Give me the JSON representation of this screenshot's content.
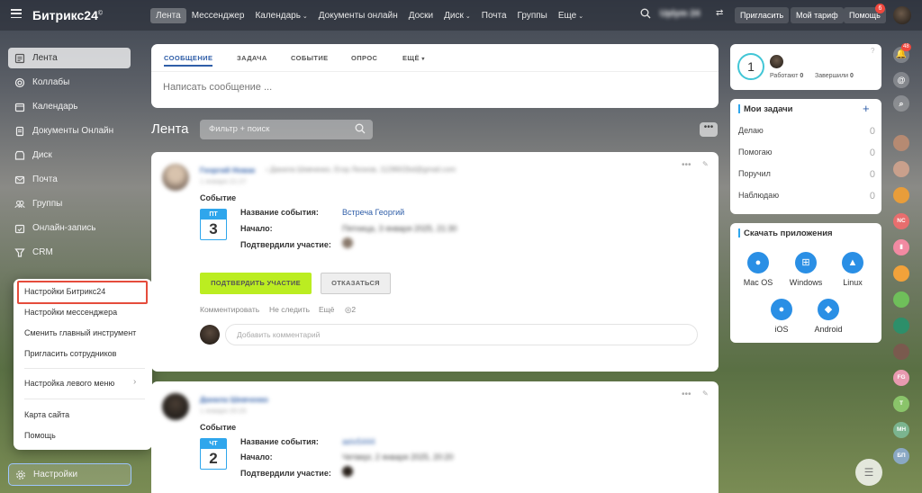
{
  "header": {
    "logo": "Битрикс24",
    "logo_sup": "©",
    "nav": [
      {
        "label": "Лента"
      },
      {
        "label": "Мессенджер"
      },
      {
        "label": "Календарь"
      },
      {
        "label": "Документы онлайн"
      },
      {
        "label": "Доски"
      },
      {
        "label": "Диск"
      },
      {
        "label": "Почта"
      },
      {
        "label": "Группы"
      },
      {
        "label": "Еще"
      }
    ],
    "user": "Uplym 24",
    "invite": "Пригласить",
    "tariff": "Мой тариф",
    "help": "Помощь",
    "help_badge": "6"
  },
  "sidebar": {
    "items": [
      {
        "label": "Лента",
        "icon": "news-icon"
      },
      {
        "label": "Коллабы",
        "icon": "collab-icon"
      },
      {
        "label": "Календарь",
        "icon": "calendar-icon"
      },
      {
        "label": "Документы Онлайн",
        "icon": "document-icon"
      },
      {
        "label": "Диск",
        "icon": "disk-icon"
      },
      {
        "label": "Почта",
        "icon": "mail-icon"
      },
      {
        "label": "Группы",
        "icon": "groups-icon"
      },
      {
        "label": "Онлайн-запись",
        "icon": "booking-icon"
      },
      {
        "label": "CRM",
        "icon": "crm-icon"
      }
    ],
    "settings": "Настройки"
  },
  "popup": {
    "items": [
      "Настройки Битрикс24",
      "Настройки мессенджера",
      "Сменить главный инструмент",
      "Пригласить сотрудников",
      "Настройка левого меню",
      "Карта сайта",
      "Помощь"
    ]
  },
  "composer": {
    "tabs": [
      "СООБЩЕНИЕ",
      "ЗАДАЧА",
      "СОБЫТИЕ",
      "ОПРОС",
      "ЕЩЁ"
    ],
    "placeholder": "Написать сообщение ..."
  },
  "feed": {
    "title": "Лента",
    "filter_placeholder": "Фильтр + поиск"
  },
  "posts": [
    {
      "author": "Георгий Новак",
      "recipients": "Данила Шевченко, Егор Леонов, 1128602bd@gmail.com",
      "date": "1 января 21:27",
      "type": "Событие",
      "cal_day": "ПТ",
      "cal_num": "3",
      "event_label": "Название события:",
      "event_name": "Встреча Георгий",
      "start_label": "Начало:",
      "start_value": "Пятница, 3 января 2025, 21:30",
      "confirmed_label": "Подтвердили участие:",
      "confirm_btn": "ПОДТВЕРДИТЬ УЧАСТИЕ",
      "decline_btn": "ОТКАЗАТЬСЯ",
      "actions": [
        "Комментировать",
        "Не следить",
        "Ещё"
      ],
      "views": "2",
      "comment_placeholder": "Добавить комментарий"
    },
    {
      "author": "Данила Шевченко",
      "date": "1 января 20:25",
      "type": "Событие",
      "cal_day": "ЧТ",
      "cal_num": "2",
      "event_label": "Название события:",
      "event_name": "aeiv5444",
      "start_label": "Начало:",
      "start_value": "Четверг, 2 января 2025, 20:20",
      "confirmed_label": "Подтвердили участие:"
    }
  ],
  "right": {
    "working_count": "1",
    "working_label": "Работают",
    "working_val": "0",
    "done_label": "Завершили",
    "done_val": "0",
    "tasks_title": "Мои задачи",
    "tasks": [
      {
        "label": "Делаю",
        "count": "0"
      },
      {
        "label": "Помогаю",
        "count": "0"
      },
      {
        "label": "Поручил",
        "count": "0"
      },
      {
        "label": "Наблюдаю",
        "count": "0"
      }
    ],
    "apps_title": "Скачать приложения",
    "apps": [
      "Mac OS",
      "Windows",
      "Linux",
      "iOS",
      "Android"
    ]
  },
  "strip": {
    "badge": "48",
    "avatars": [
      "NC",
      "FG",
      "T",
      "МН",
      "БП"
    ]
  }
}
